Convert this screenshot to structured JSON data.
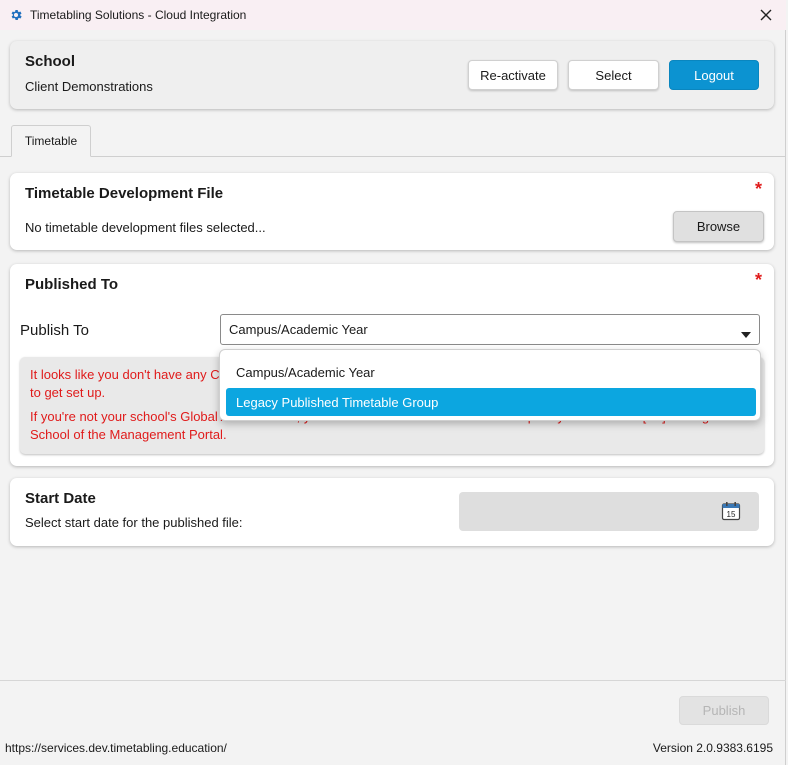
{
  "window": {
    "title": "Timetabling Solutions - Cloud Integration",
    "icon": "gear-icon",
    "close_icon": "close-icon"
  },
  "school": {
    "heading": "School",
    "name": "Client Demonstrations",
    "reactivate_label": "Re-activate",
    "select_label": "Select",
    "logout_label": "Logout"
  },
  "tabs": [
    {
      "label": "Timetable",
      "active": true
    }
  ],
  "dev_file": {
    "heading": "Timetable Development File",
    "required_mark": "*",
    "status": "No timetable development files selected...",
    "browse_label": "Browse"
  },
  "published_to": {
    "heading": "Published To",
    "required_mark": "*",
    "field_label": "Publish To",
    "selected_value": "Campus/Academic Year",
    "options": [
      {
        "label": "Campus/Academic Year",
        "highlighted": false
      },
      {
        "label": "Legacy Published Timetable Group",
        "highlighted": true
      }
    ],
    "warning_line1": "It looks like you don't have any C",
    "warning_line2": "to get set up.",
    "warning_line3": "If you're not your school's Global Administrator, you will need to contact them to set it up for you on screen [2A] Manage",
    "warning_line4": "School of the Management Portal."
  },
  "start_date": {
    "heading": "Start Date",
    "description": "Select start date for the published file:",
    "calendar_icon": "calendar-icon",
    "calendar_day": "15"
  },
  "footer": {
    "publish_label": "Publish",
    "url": "https://services.dev.timetabling.education/",
    "version": "Version 2.0.9383.6195"
  },
  "colors": {
    "accent": "#0c93d1",
    "highlight": "#0ca6e0",
    "required": "#e01b1b",
    "titlebar": "#f9eff3"
  }
}
